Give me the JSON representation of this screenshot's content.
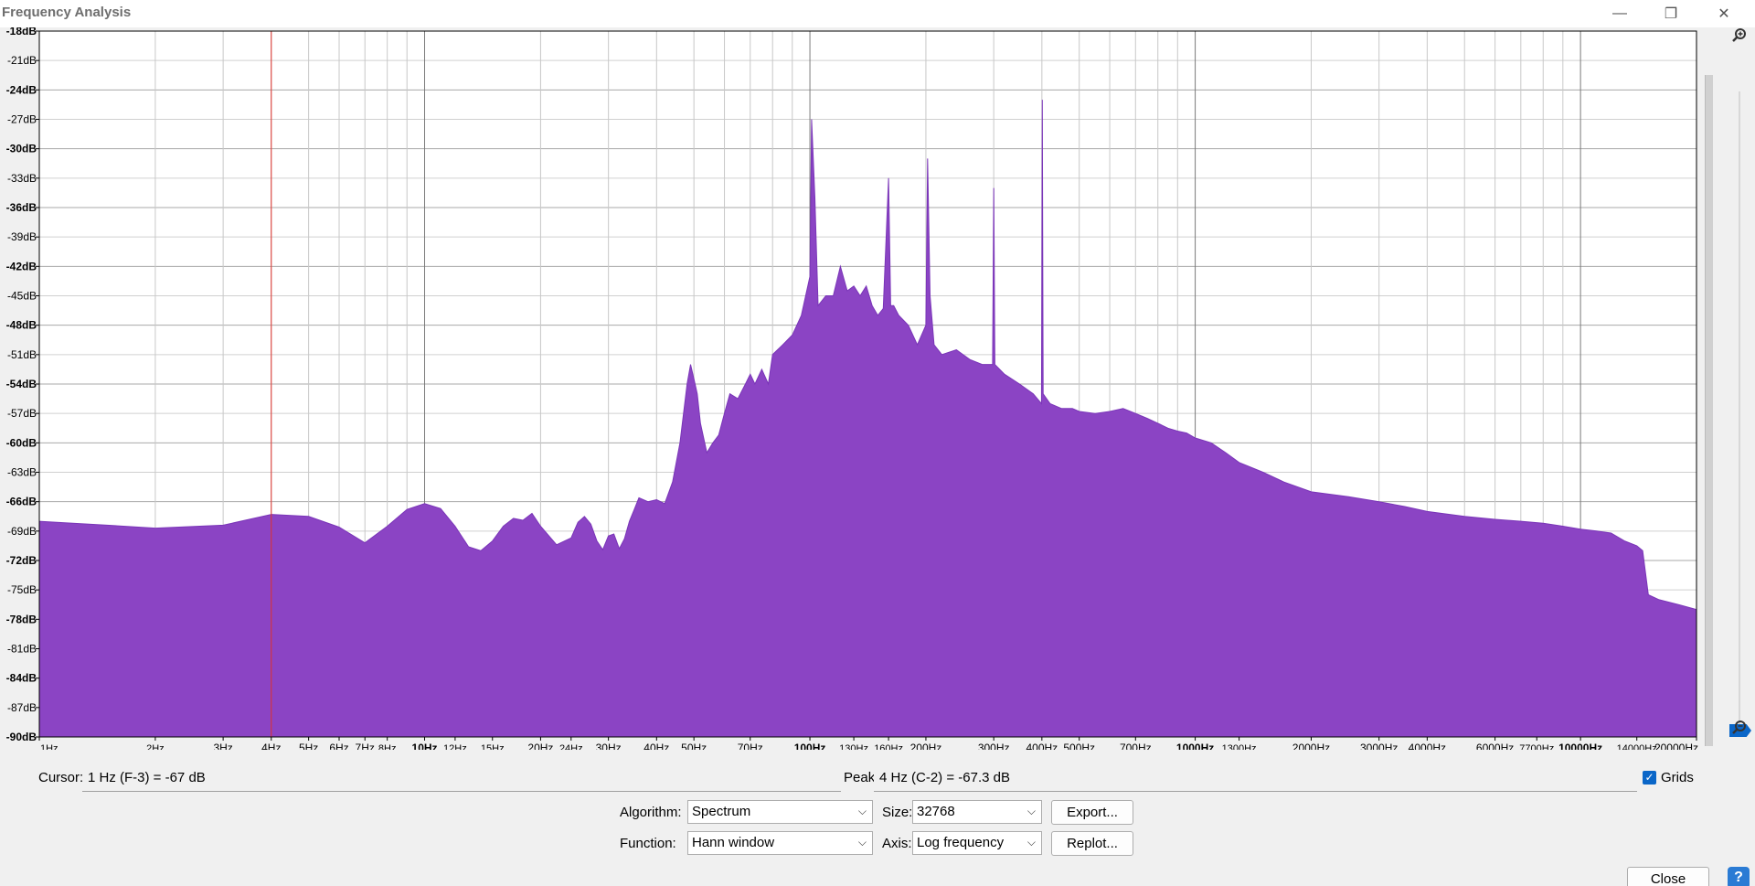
{
  "window": {
    "title": "Frequency Analysis",
    "controls": {
      "minimize": "—",
      "restore": "❐",
      "close": "✕"
    }
  },
  "chart_data": {
    "type": "area",
    "x_scale": "log",
    "xlim": [
      1,
      20000
    ],
    "ylim": [
      -90,
      -18
    ],
    "ylabel": "",
    "xlabel": "",
    "grid": true,
    "fill_color": "#8b44c4",
    "cursor_frequency_hz": 4,
    "cursor_color": "#e0302c",
    "y_ticks": [
      "-18dB",
      "-21dB",
      "-24dB",
      "-27dB",
      "-30dB",
      "-33dB",
      "-36dB",
      "-39dB",
      "-42dB",
      "-45dB",
      "-48dB",
      "-51dB",
      "-54dB",
      "-57dB",
      "-60dB",
      "-63dB",
      "-66dB",
      "-69dB",
      "-72dB",
      "-75dB",
      "-78dB",
      "-81dB",
      "-84dB",
      "-87dB",
      "-90dB"
    ],
    "x_ticks": [
      {
        "hz": 1,
        "label": "1Hz",
        "major": false
      },
      {
        "hz": 2,
        "label": "2Hz",
        "major": false
      },
      {
        "hz": 3,
        "label": "3Hz",
        "major": false
      },
      {
        "hz": 4,
        "label": "4Hz",
        "major": false
      },
      {
        "hz": 5,
        "label": "5Hz",
        "major": false
      },
      {
        "hz": 6,
        "label": "6Hz",
        "major": false
      },
      {
        "hz": 7,
        "label": "7Hz",
        "major": false
      },
      {
        "hz": 8,
        "label": "8Hz",
        "major": false
      },
      {
        "hz": 10,
        "label": "10Hz",
        "major": true
      },
      {
        "hz": 12,
        "label": "12Hz",
        "major": false
      },
      {
        "hz": 15,
        "label": "15Hz",
        "major": false
      },
      {
        "hz": 20,
        "label": "20Hz",
        "major": false
      },
      {
        "hz": 24,
        "label": "24Hz",
        "major": false
      },
      {
        "hz": 30,
        "label": "30Hz",
        "major": false
      },
      {
        "hz": 40,
        "label": "40Hz",
        "major": false
      },
      {
        "hz": 50,
        "label": "50Hz",
        "major": false
      },
      {
        "hz": 70,
        "label": "70Hz",
        "major": false
      },
      {
        "hz": 100,
        "label": "100Hz",
        "major": true
      },
      {
        "hz": 130,
        "label": "130Hz",
        "major": false
      },
      {
        "hz": 160,
        "label": "160Hz",
        "major": false
      },
      {
        "hz": 200,
        "label": "200Hz",
        "major": false
      },
      {
        "hz": 300,
        "label": "300Hz",
        "major": false
      },
      {
        "hz": 400,
        "label": "400Hz",
        "major": false
      },
      {
        "hz": 500,
        "label": "500Hz",
        "major": false
      },
      {
        "hz": 700,
        "label": "700Hz",
        "major": false
      },
      {
        "hz": 1000,
        "label": "1000Hz",
        "major": true
      },
      {
        "hz": 1300,
        "label": "1300Hz",
        "major": false
      },
      {
        "hz": 2000,
        "label": "2000Hz",
        "major": false
      },
      {
        "hz": 3000,
        "label": "3000Hz",
        "major": false
      },
      {
        "hz": 4000,
        "label": "4000Hz",
        "major": false
      },
      {
        "hz": 6000,
        "label": "6000Hz",
        "major": false
      },
      {
        "hz": 7700,
        "label": "7700Hz",
        "major": false
      },
      {
        "hz": 10000,
        "label": "10000Hz",
        "major": true
      },
      {
        "hz": 14000,
        "label": "14000Hz",
        "major": false
      },
      {
        "hz": 20000,
        "label": "20000Hz",
        "major": false
      }
    ],
    "series": [
      {
        "x": [
          1,
          1.5,
          2,
          3,
          4,
          5,
          6,
          7,
          8,
          9,
          10,
          11,
          12,
          13,
          14,
          15,
          16,
          17,
          18,
          19,
          20,
          22,
          24,
          25,
          26,
          27,
          28,
          29,
          30,
          31,
          32,
          33,
          34,
          35,
          36,
          38,
          40,
          42,
          44,
          46,
          48,
          49,
          50,
          51,
          52,
          54,
          56,
          58,
          60,
          62,
          65,
          68,
          70,
          72,
          75,
          78,
          80,
          85,
          90,
          95,
          100,
          101,
          103,
          105,
          110,
          115,
          120,
          125,
          130,
          135,
          140,
          145,
          150,
          155,
          160,
          162,
          165,
          170,
          180,
          190,
          200,
          202,
          205,
          210,
          220,
          240,
          260,
          280,
          298,
          300,
          302,
          320,
          350,
          380,
          399,
          401,
          403,
          420,
          450,
          480,
          500,
          550,
          600,
          650,
          700,
          750,
          800,
          850,
          900,
          950,
          1000,
          1100,
          1200,
          1300,
          1500,
          1700,
          2000,
          2500,
          3000,
          3500,
          4000,
          5000,
          6000,
          7000,
          8000,
          9000,
          10000,
          11000,
          12000,
          13000,
          14000,
          14500,
          15000,
          16000,
          18000,
          20000
        ],
        "y": [
          -68,
          -68.4,
          -68.7,
          -68.4,
          -67.3,
          -67.5,
          -68.6,
          -70.2,
          -68.5,
          -66.8,
          -66.2,
          -66.7,
          -68.5,
          -70.6,
          -71,
          -70,
          -68.5,
          -67.7,
          -67.9,
          -67.2,
          -68.5,
          -70.4,
          -69.7,
          -68.1,
          -67.5,
          -68.3,
          -70,
          -70.9,
          -69.5,
          -69.3,
          -70.8,
          -69.8,
          -68,
          -66.8,
          -65.6,
          -66,
          -65.8,
          -66.2,
          -64,
          -60,
          -54,
          -52,
          -53.5,
          -55,
          -58,
          -61,
          -60,
          -59.2,
          -57,
          -55,
          -55.5,
          -54,
          -53,
          -54,
          -52.5,
          -54,
          -51,
          -50,
          -49,
          -47,
          -43,
          -27,
          -35,
          -46,
          -45,
          -45,
          -42,
          -44.5,
          -44,
          -45,
          -44,
          -46,
          -47,
          -46.3,
          -33,
          -46,
          -46,
          -47,
          -48,
          -50,
          -48,
          -31,
          -45,
          -50,
          -51,
          -50.5,
          -51.5,
          -52,
          -52,
          -34,
          -52,
          -53,
          -54,
          -55,
          -56,
          -25,
          -55,
          -56,
          -56.5,
          -56.5,
          -56.8,
          -57,
          -56.8,
          -56.5,
          -57,
          -57.5,
          -58,
          -58.5,
          -58.8,
          -59,
          -59.5,
          -60,
          -61,
          -62,
          -63,
          -64,
          -65,
          -65.5,
          -66,
          -66.5,
          -67,
          -67.5,
          -67.8,
          -68,
          -68.2,
          -68.5,
          -68.8,
          -69,
          -69.2,
          -70,
          -70.5,
          -71,
          -75.5,
          -76,
          -76.5,
          -77
        ]
      }
    ]
  },
  "cursor": {
    "label": "Cursor:",
    "value": "1 Hz (F-3) = -67 dB"
  },
  "peak": {
    "label": "Peak:",
    "value": "4 Hz (C-2) = -67.3 dB"
  },
  "grids": {
    "label": "Grids",
    "checked": true
  },
  "controls": {
    "algorithm_label": "Algorithm:",
    "algorithm_value": "Spectrum",
    "function_label": "Function:",
    "function_value": "Hann window",
    "size_label": "Size:",
    "size_value": "32768",
    "axis_label": "Axis:",
    "axis_value": "Log frequency",
    "export_label": "Export...",
    "replot_label": "Replot...",
    "close_label": "Close",
    "help_label": "?"
  },
  "icons": {
    "zoom_in": "zoom-in-icon",
    "zoom_out": "zoom-out-icon"
  }
}
